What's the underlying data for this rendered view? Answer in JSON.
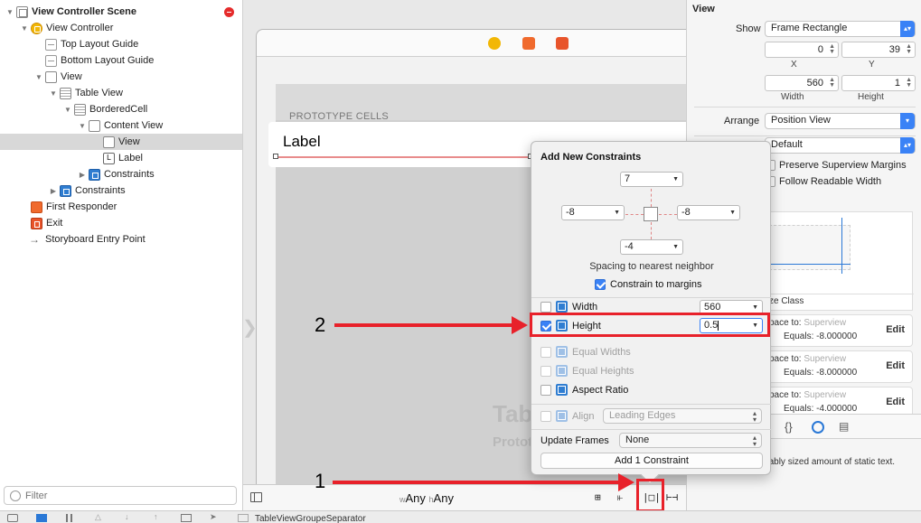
{
  "outline": {
    "items": [
      {
        "label": "View Controller Scene",
        "icon": "scene-icon",
        "indent": 0,
        "expanded": true,
        "bold": true
      },
      {
        "label": "View Controller",
        "icon": "view-controller-icon",
        "indent": 1,
        "expanded": true
      },
      {
        "label": "Top Layout Guide",
        "icon": "layout-guide-icon",
        "indent": 2
      },
      {
        "label": "Bottom Layout Guide",
        "icon": "layout-guide-icon",
        "indent": 2
      },
      {
        "label": "View",
        "icon": "view-icon",
        "indent": 2,
        "expanded": true
      },
      {
        "label": "Table View",
        "icon": "table-view-icon",
        "indent": 3,
        "expanded": true
      },
      {
        "label": "BorderedCell",
        "icon": "table-cell-icon",
        "indent": 4,
        "expanded": true
      },
      {
        "label": "Content View",
        "icon": "view-icon",
        "indent": 5,
        "expanded": true
      },
      {
        "label": "View",
        "icon": "view-icon",
        "indent": 6,
        "selected": true
      },
      {
        "label": "Label",
        "icon": "label-icon",
        "indent": 6
      },
      {
        "label": "Constraints",
        "icon": "constraints-icon",
        "indent": 5,
        "collapsed": true
      },
      {
        "label": "Constraints",
        "icon": "constraints-icon",
        "indent": 3,
        "collapsed": true
      },
      {
        "label": "First Responder",
        "icon": "first-responder-icon",
        "indent": 1
      },
      {
        "label": "Exit",
        "icon": "exit-icon",
        "indent": 1
      },
      {
        "label": "Storyboard Entry Point",
        "icon": "entry-arrow-icon",
        "indent": 1
      }
    ],
    "filter_placeholder": "Filter",
    "bottom_label": "TableViewGroupeSeparator"
  },
  "canvas": {
    "prototype_cells": "PROTOTYPE CELLS",
    "cell_label": "Label",
    "watermark_title": "Table",
    "watermark_sub": "Prototype",
    "size_class_w": "w",
    "size_class_w_value": "Any",
    "size_class_h": "h",
    "size_class_h_value": "Any"
  },
  "inspector": {
    "section_title": "View",
    "show_label": "Show",
    "show_value": "Frame Rectangle",
    "x_value": "0",
    "y_value": "39",
    "x_label": "X",
    "y_label": "Y",
    "width_value": "560",
    "height_value": "1",
    "width_label": "Width",
    "height_label": "Height",
    "arrange_label": "Arrange",
    "arrange_value": "Position View",
    "layout_value": "Default",
    "preserve_margins": "Preserve Superview Margins",
    "follow_readable": "Follow Readable Width",
    "size_class_caption": "ze Class",
    "constraints": [
      {
        "space_to": "pace to:",
        "superview": "Superview",
        "equals": "Equals:",
        "value": "-8.000000",
        "edit": "Edit"
      },
      {
        "space_to": "pace to:",
        "superview": "Superview",
        "equals": "Equals:",
        "value": "-8.000000",
        "edit": "Edit"
      },
      {
        "space_to": "pace to:",
        "superview": "Superview",
        "equals": "Equals:",
        "value": "-4.000000",
        "edit": "Edit"
      }
    ],
    "description": "- A variably sized amount of static text."
  },
  "popover": {
    "title": "Add New Constraints",
    "top_value": "7",
    "left_value": "-8",
    "right_value": "-8",
    "bottom_value": "-4",
    "spacing_label": "Spacing to nearest neighbor",
    "constrain_margins": "Constrain to margins",
    "width_label": "Width",
    "width_value": "560",
    "height_label": "Height",
    "height_value": "0.5",
    "equal_widths": "Equal Widths",
    "equal_heights": "Equal Heights",
    "aspect_ratio": "Aspect Ratio",
    "align_label": "Align",
    "align_value": "Leading Edges",
    "update_frames_label": "Update Frames",
    "update_frames_value": "None",
    "add_button": "Add 1 Constraint"
  },
  "annotations": {
    "step1": "1",
    "step2": "2",
    "color": "#e8212a"
  }
}
